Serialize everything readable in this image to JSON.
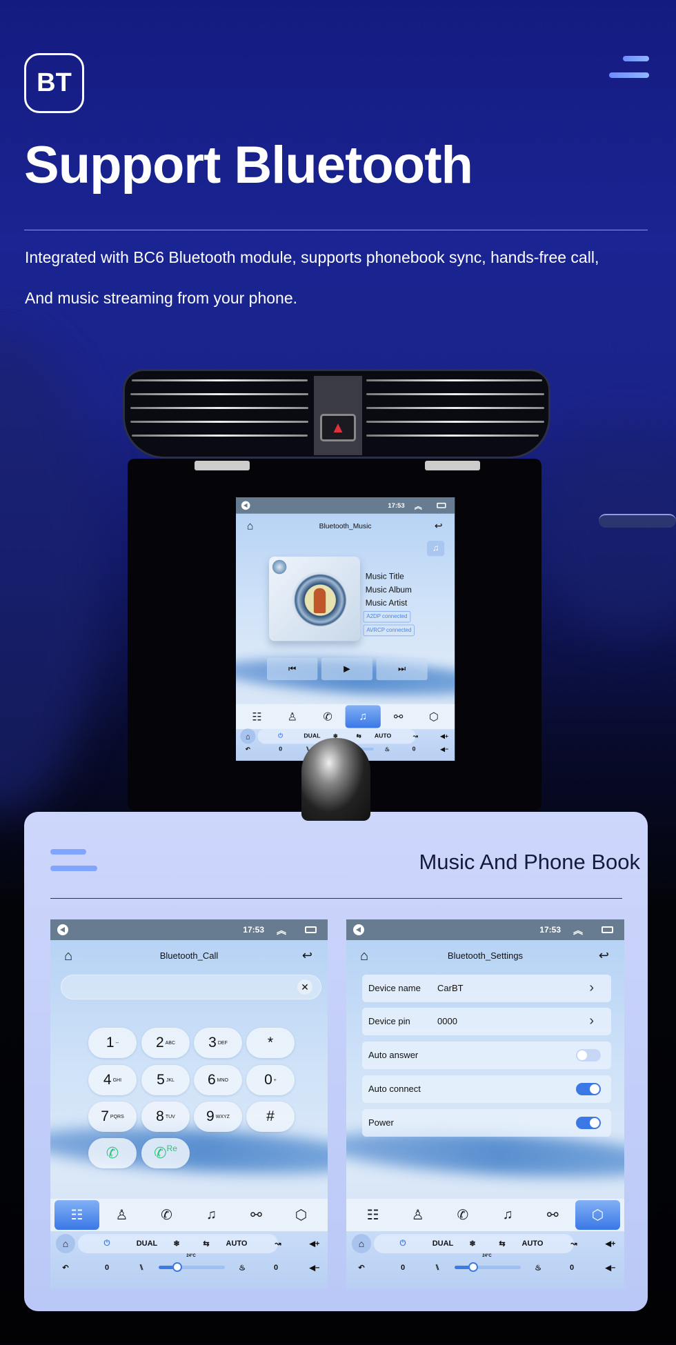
{
  "header": {
    "logo": "BT",
    "title": "Support Bluetooth",
    "description_lines": [
      "Integrated with BC6 Bluetooth module, supports phonebook sync, hands-free call,",
      "And music streaming from your phone."
    ],
    "menu_icon": "hamburger-icon"
  },
  "status_bar": {
    "time": "17:53",
    "icons": [
      "volume-icon",
      "double-chevron-up-icon",
      "window-icon"
    ]
  },
  "nav_tabs": [
    {
      "icon": "keypad-icon",
      "glyph": "☷"
    },
    {
      "icon": "contacts-icon",
      "glyph": "♙"
    },
    {
      "icon": "call-log-icon",
      "glyph": "✆"
    },
    {
      "icon": "music-icon",
      "glyph": "♫"
    },
    {
      "icon": "link-icon",
      "glyph": "⚯"
    },
    {
      "icon": "settings-icon",
      "glyph": "⬡"
    }
  ],
  "climate": {
    "dual": "DUAL",
    "auto": "AUTO",
    "temp": "24°C",
    "left_value": "0",
    "right_value": "0",
    "fan_level": 0.28
  },
  "music_screen": {
    "title": "Bluetooth_Music",
    "music_title": "Music Title",
    "music_album": "Music Album",
    "music_artist": "Music Artist",
    "badges": [
      "A2DP connected",
      "AVRCP connected"
    ],
    "active_tab": 3
  },
  "card": {
    "title": "Music And Phone Book"
  },
  "call_screen": {
    "title": "Bluetooth_Call",
    "input_value": "",
    "active_tab": 0,
    "keys": [
      {
        "d": "1",
        "l": "--"
      },
      {
        "d": "2",
        "l": "ABC"
      },
      {
        "d": "3",
        "l": "DEF"
      },
      {
        "d": "*",
        "l": ""
      },
      {
        "d": "4",
        "l": "GHI"
      },
      {
        "d": "5",
        "l": "JKL"
      },
      {
        "d": "6",
        "l": "MNO"
      },
      {
        "d": "0",
        "l": "+"
      },
      {
        "d": "7",
        "l": "PQRS"
      },
      {
        "d": "8",
        "l": "TUV"
      },
      {
        "d": "9",
        "l": "WXYZ"
      },
      {
        "d": "#",
        "l": ""
      }
    ],
    "redial_label": "Re"
  },
  "settings_screen": {
    "title": "Bluetooth_Settings",
    "active_tab": 5,
    "rows": [
      {
        "label": "Device name",
        "value": "CarBT",
        "type": "link"
      },
      {
        "label": "Device pin",
        "value": "0000",
        "type": "link"
      },
      {
        "label": "Auto answer",
        "type": "toggle",
        "on": false
      },
      {
        "label": "Auto connect",
        "type": "toggle",
        "on": true
      },
      {
        "label": "Power",
        "type": "toggle",
        "on": true
      }
    ]
  },
  "colors": {
    "accent": "#3a78e6",
    "status_bar": "#677b91",
    "call_green": "#2fc47c",
    "card_bg": "#c4cffa"
  }
}
